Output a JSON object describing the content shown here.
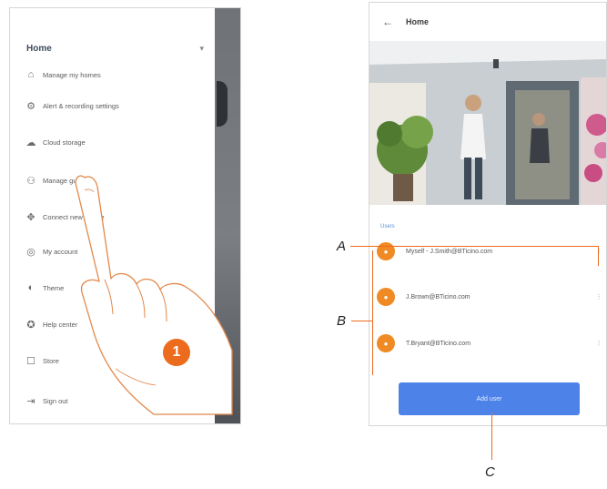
{
  "left_phone": {
    "menu_title": "Home",
    "menu_items": [
      {
        "label": "Manage my homes",
        "icon": "house-icon"
      },
      {
        "label": "Alert & recording settings",
        "icon": "alert-settings-icon"
      },
      {
        "label": "Cloud storage",
        "icon": "cloud-storage-icon"
      },
      {
        "label": "Manage guests",
        "icon": "guests-icon"
      },
      {
        "label": "Connect new device",
        "icon": "connect-icon"
      },
      {
        "label": "My account",
        "icon": "account-icon"
      },
      {
        "label": "Theme",
        "icon": "theme-icon"
      },
      {
        "label": "Help center",
        "icon": "help-icon"
      },
      {
        "label": "Store",
        "icon": "store-icon"
      },
      {
        "label": "Sign out",
        "icon": "sign-out-icon"
      }
    ],
    "step_badge": "1"
  },
  "right_phone": {
    "title": "Home",
    "section_label": "Users",
    "users": [
      {
        "email": "Myself - J.Smith@BTicino.com"
      },
      {
        "email": "J.Brown@BTicino.com"
      },
      {
        "email": "T.Bryant@BTicino.com"
      }
    ],
    "add_button": "Add user"
  },
  "callouts": {
    "a": "A",
    "b": "B",
    "c": "C"
  },
  "colors": {
    "accent": "#ec6b1c",
    "button": "#4d82e8",
    "avatar": "#f08a24"
  }
}
